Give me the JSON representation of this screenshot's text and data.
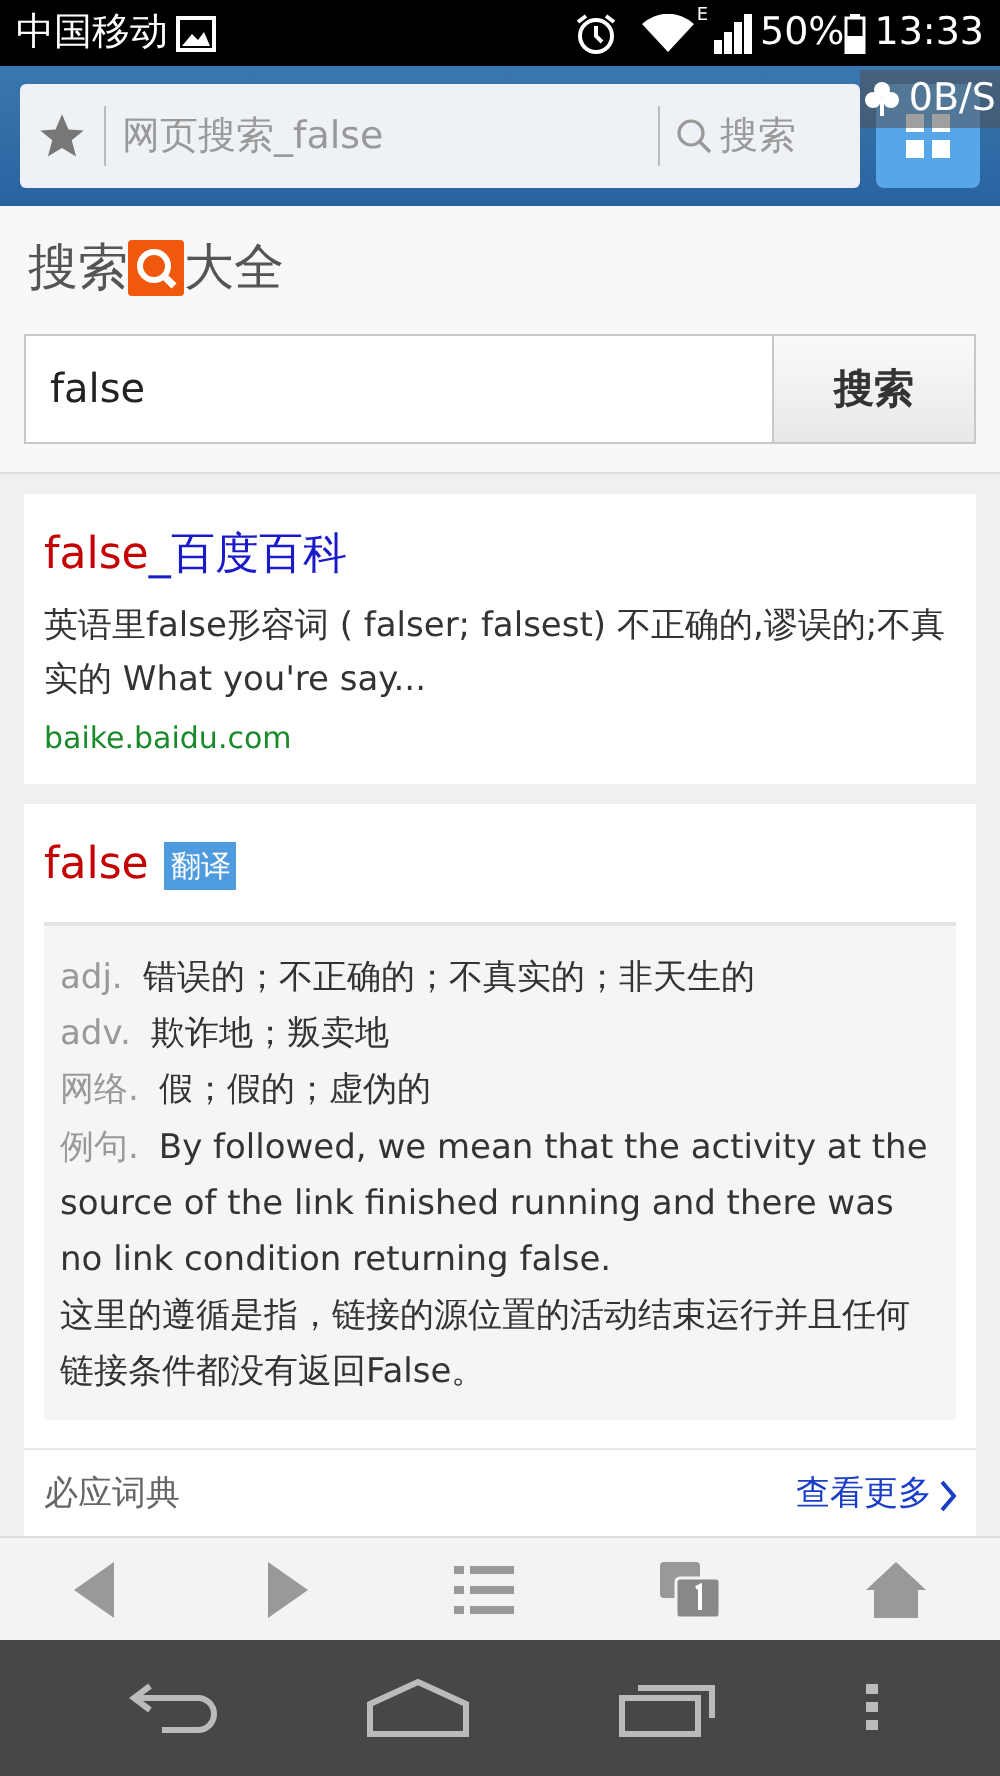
{
  "status_bar": {
    "carrier": "中国移动",
    "network_type": "E",
    "battery": "50%",
    "time": "13:33"
  },
  "browser_bar": {
    "address": "网页搜索_false",
    "search_label": "搜索",
    "speed": "0B/S"
  },
  "page": {
    "title_left": "搜索",
    "title_right": "大全",
    "query": "false",
    "search_button": "搜索",
    "results": [
      {
        "kind": "web",
        "title_keyword": "false",
        "title_rest": "_百度百科",
        "snippet": "英语里false形容词 ( falser; falsest) 不正确的,谬误的;不真实的 What you're say...",
        "url": "baike.baidu.com"
      },
      {
        "kind": "dictionary",
        "word": "false",
        "tag": "翻译",
        "definitions": [
          {
            "pos": "adj.",
            "text": "错误的；不正确的；不真实的；非天生的"
          },
          {
            "pos": "adv.",
            "text": "欺诈地；叛卖地"
          },
          {
            "pos": "网络.",
            "text": "假；假的；虚伪的"
          }
        ],
        "example_label": "例句.",
        "example_en": "By followed, we mean that the activity at the source of the link finished running and there was no link condition returning false.",
        "example_zh": "这里的遵循是指，链接的源位置的活动结束运行并且任何链接条件都没有返回False。",
        "source": "必应词典",
        "more": "查看更多"
      }
    ]
  }
}
